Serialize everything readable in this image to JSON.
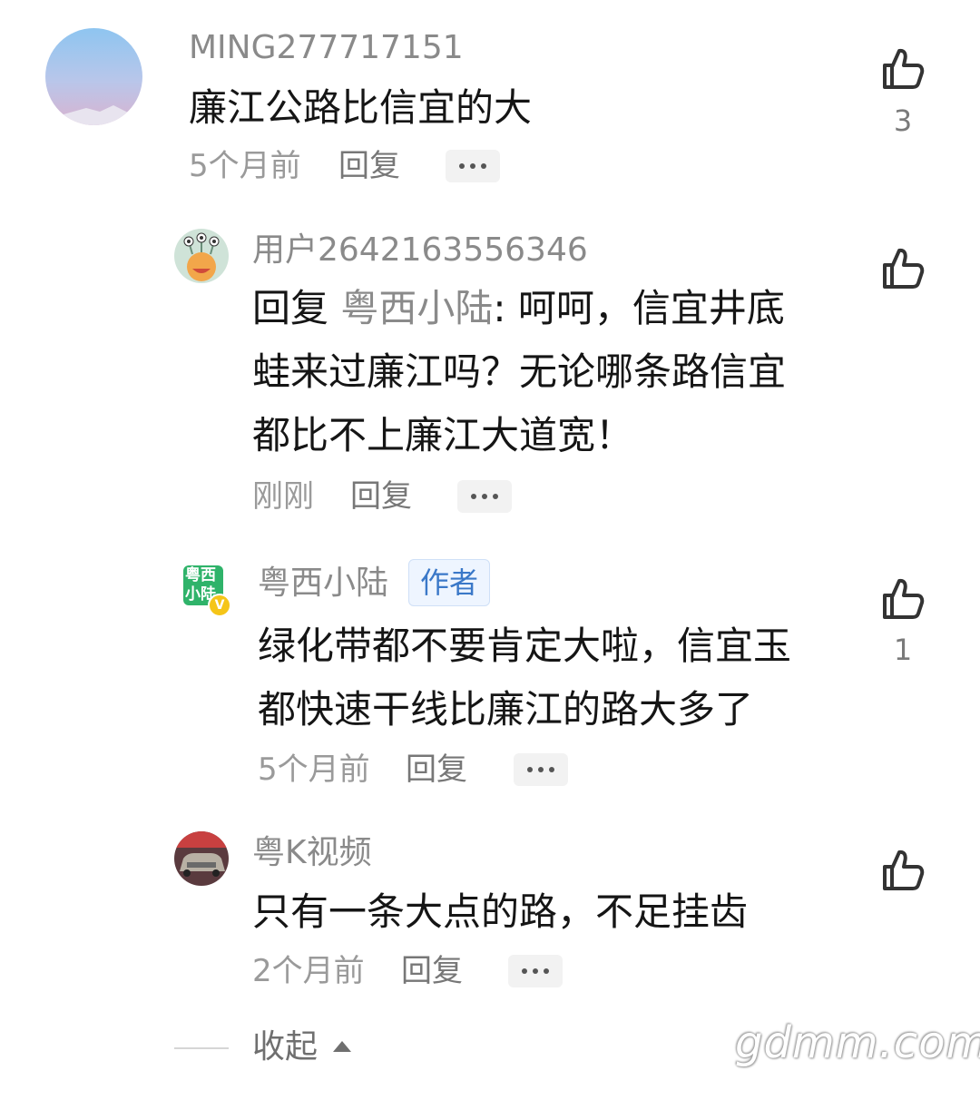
{
  "comments": [
    {
      "username": "MING277717151",
      "lines": [
        "廉江公路比信宜的大"
      ],
      "time": "5个月前",
      "reply_label": "回复",
      "likes": "3",
      "avatar_icon": "sky-avatar"
    },
    {
      "username": "用户2642163556346",
      "reply_prefix": "回复",
      "mention": "粤西小陆",
      "line1_rest": ": 呵呵，信宜井底",
      "line2": "蛙来过廉江吗？无论哪条路信宜",
      "line3": "都比不上廉江大道宽！",
      "time": "刚刚",
      "reply_label": "回复",
      "avatar_icon": "monster-avatar"
    },
    {
      "username": "粤西小陆",
      "badge": "作者",
      "lines": [
        "绿化带都不要肯定大啦，信宜玉",
        "都快速干线比廉江的路大多了"
      ],
      "time": "5个月前",
      "reply_label": "回复",
      "likes": "1",
      "avatar_text_top": "粤西",
      "avatar_text_bottom": "小陆",
      "verified_mark": "V"
    },
    {
      "username": "粤K视频",
      "lines": [
        "只有一条大点的路，不足挂齿"
      ],
      "time": "2个月前",
      "reply_label": "回复",
      "avatar_icon": "car-avatar"
    }
  ],
  "collapse_label": "收起",
  "watermark": "gdmm.com",
  "colors": {
    "author_badge_text": "#3a78c8",
    "author_avatar_bg": "#2fb36a",
    "muted_text": "#8a8a8a"
  }
}
